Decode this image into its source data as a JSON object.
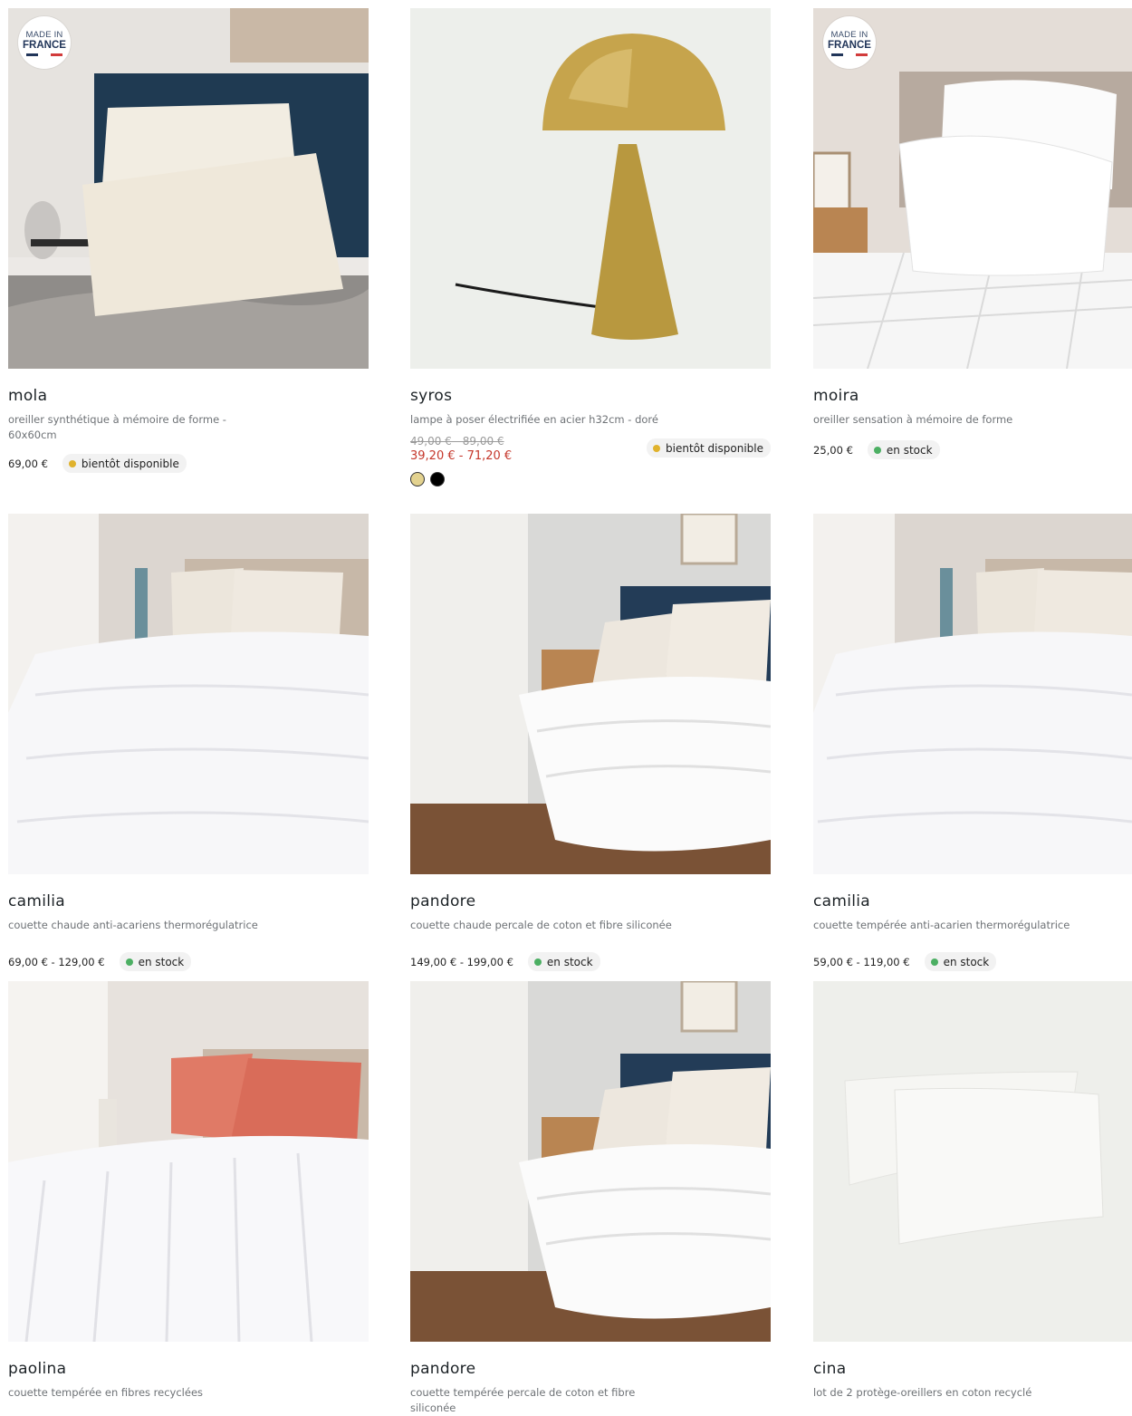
{
  "badges": {
    "line1": "MADE IN",
    "line2": "FRANCE"
  },
  "colors": {
    "in_stock": "#4caf63",
    "soon": "#e0b22c",
    "promo_price": "#c5372b",
    "flag_blue": "#213559",
    "flag_white": "#ffffff",
    "flag_red": "#d23b3b"
  },
  "products": [
    {
      "name": "mola",
      "description": "oreiller synthétique à mémoire de forme - 60x60cm",
      "price": "69,00 €",
      "status": "bientôt disponible",
      "status_type": "soon",
      "made_in_france": true
    },
    {
      "name": "syros",
      "description": "lampe à poser électrifiée en acier h32cm - doré",
      "old_price": "49,00 € - 89,00 €",
      "price": "39,20 € - 71,20 €",
      "status": "bientôt disponible",
      "status_type": "soon",
      "swatches": [
        "gold",
        "black"
      ]
    },
    {
      "name": "moira",
      "description": "oreiller sensation à mémoire de forme",
      "price": "25,00 €",
      "status": "en stock",
      "status_type": "in_stock",
      "made_in_france": true
    },
    {
      "name": "camilia",
      "description": "couette chaude anti-acariens thermorégulatrice",
      "price": "69,00 € - 129,00 €",
      "status": "en stock",
      "status_type": "in_stock"
    },
    {
      "name": "pandore",
      "description": "couette chaude percale de coton et fibre siliconée",
      "price": "149,00 € - 199,00 €",
      "status": "en stock",
      "status_type": "in_stock"
    },
    {
      "name": "camilia",
      "description": "couette tempérée anti-acarien thermorégulatrice",
      "price": "59,00 € - 119,00 €",
      "status": "en stock",
      "status_type": "in_stock"
    },
    {
      "name": "paolina",
      "description": "couette tempérée en fibres recyclées"
    },
    {
      "name": "pandore",
      "description": "couette tempérée percale de coton et fibre siliconée"
    },
    {
      "name": "cina",
      "description": "lot de 2 protège-oreillers en coton recyclé"
    }
  ]
}
